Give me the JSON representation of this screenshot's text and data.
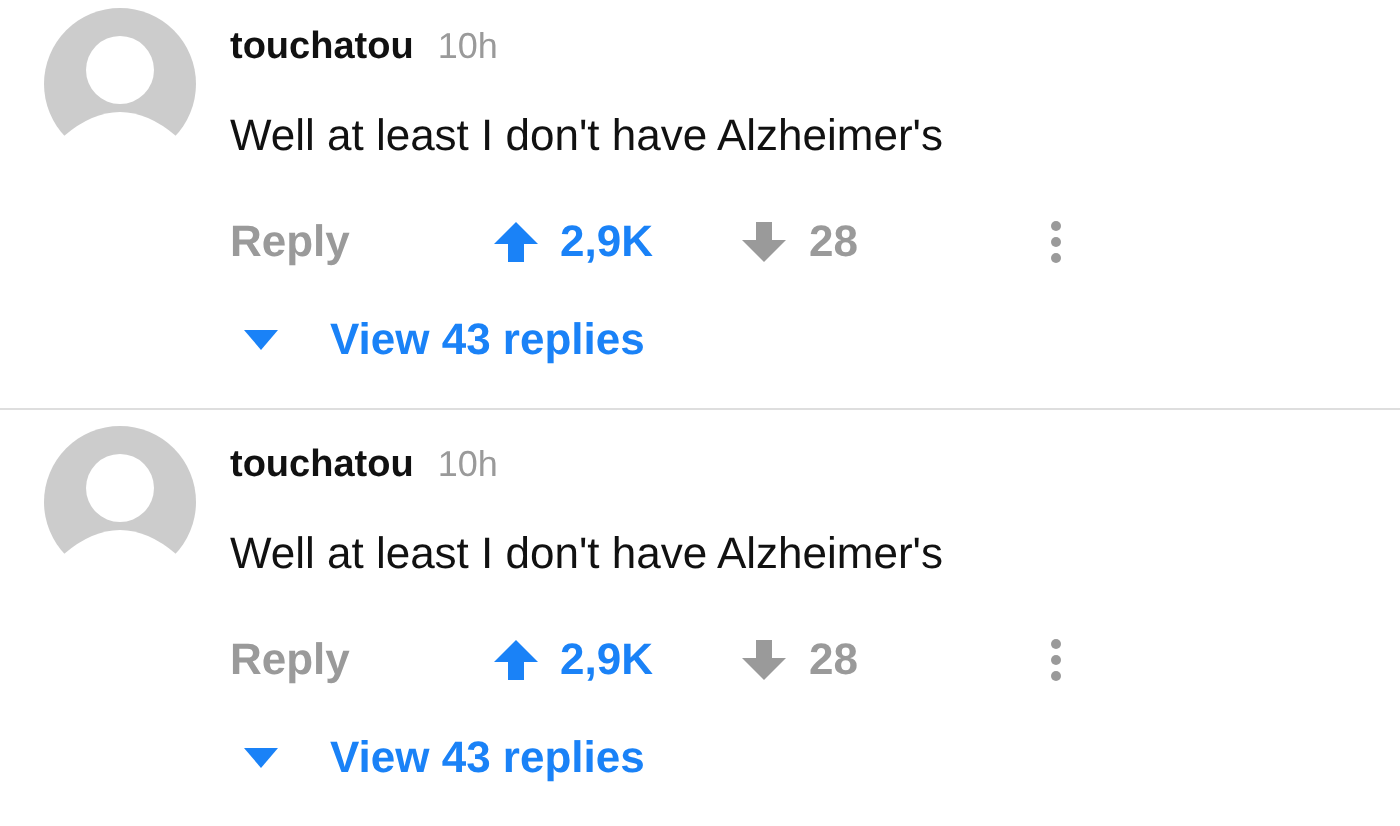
{
  "comments": [
    {
      "author": "touchatou",
      "time": "10h",
      "body": "Well at least I don't have Alzheimer's",
      "reply": "Reply",
      "upvotes": "2,9K",
      "upvoted": true,
      "downvotes": "28",
      "downvoted": false,
      "view_replies": "View 43 replies"
    },
    {
      "author": "touchatou",
      "time": "10h",
      "body": "Well at least I don't have Alzheimer's",
      "reply": "Reply",
      "upvotes": "2,9K",
      "upvoted": true,
      "downvotes": "28",
      "downvoted": false,
      "view_replies": "View 43 replies"
    }
  ]
}
